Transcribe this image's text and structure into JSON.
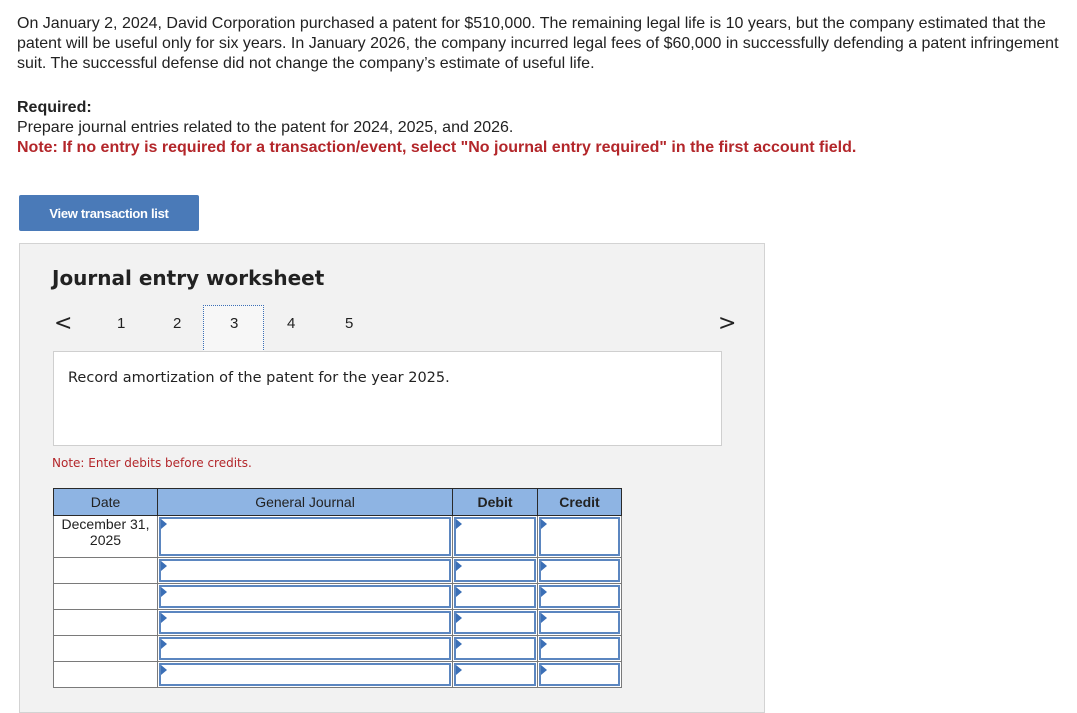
{
  "problem": {
    "text": "On January 2, 2024, David Corporation purchased a patent for $510,000. The remaining legal life is 10 years, but the company estimated that the patent will be useful only for six years. In January 2026, the company incurred legal fees of $60,000 in successfully defending a patent infringement suit. The successful defense did not change the company’s estimate of useful life."
  },
  "required": {
    "title": "Required:",
    "text": "Prepare journal entries related to the patent for 2024, 2025, and 2026.",
    "note": "Note: If no entry is required for a transaction/event, select \"No journal entry required\" in the first account field."
  },
  "buttons": {
    "view_transaction_list": "View transaction list"
  },
  "worksheet": {
    "title": "Journal entry worksheet",
    "nav_prev": "<",
    "nav_next": ">",
    "pages": [
      "1",
      "2",
      "3",
      "4",
      "5"
    ],
    "active_page": "3",
    "description": "Record amortization of the patent for the year 2025.",
    "note": "Note: Enter debits before credits.",
    "table": {
      "headers": {
        "date": "Date",
        "general_journal": "General Journal",
        "debit": "Debit",
        "credit": "Credit"
      },
      "rows": [
        {
          "date": "December 31, 2025",
          "account": "",
          "debit": "",
          "credit": ""
        },
        {
          "date": "",
          "account": "",
          "debit": "",
          "credit": ""
        },
        {
          "date": "",
          "account": "",
          "debit": "",
          "credit": ""
        },
        {
          "date": "",
          "account": "",
          "debit": "",
          "credit": ""
        },
        {
          "date": "",
          "account": "",
          "debit": "",
          "credit": ""
        },
        {
          "date": "",
          "account": "",
          "debit": "",
          "credit": ""
        }
      ]
    }
  },
  "colors": {
    "accent_button": "#4a7ab8",
    "table_header": "#8eb4e3",
    "note_red": "#b3262a",
    "input_border": "#5b86c0"
  }
}
